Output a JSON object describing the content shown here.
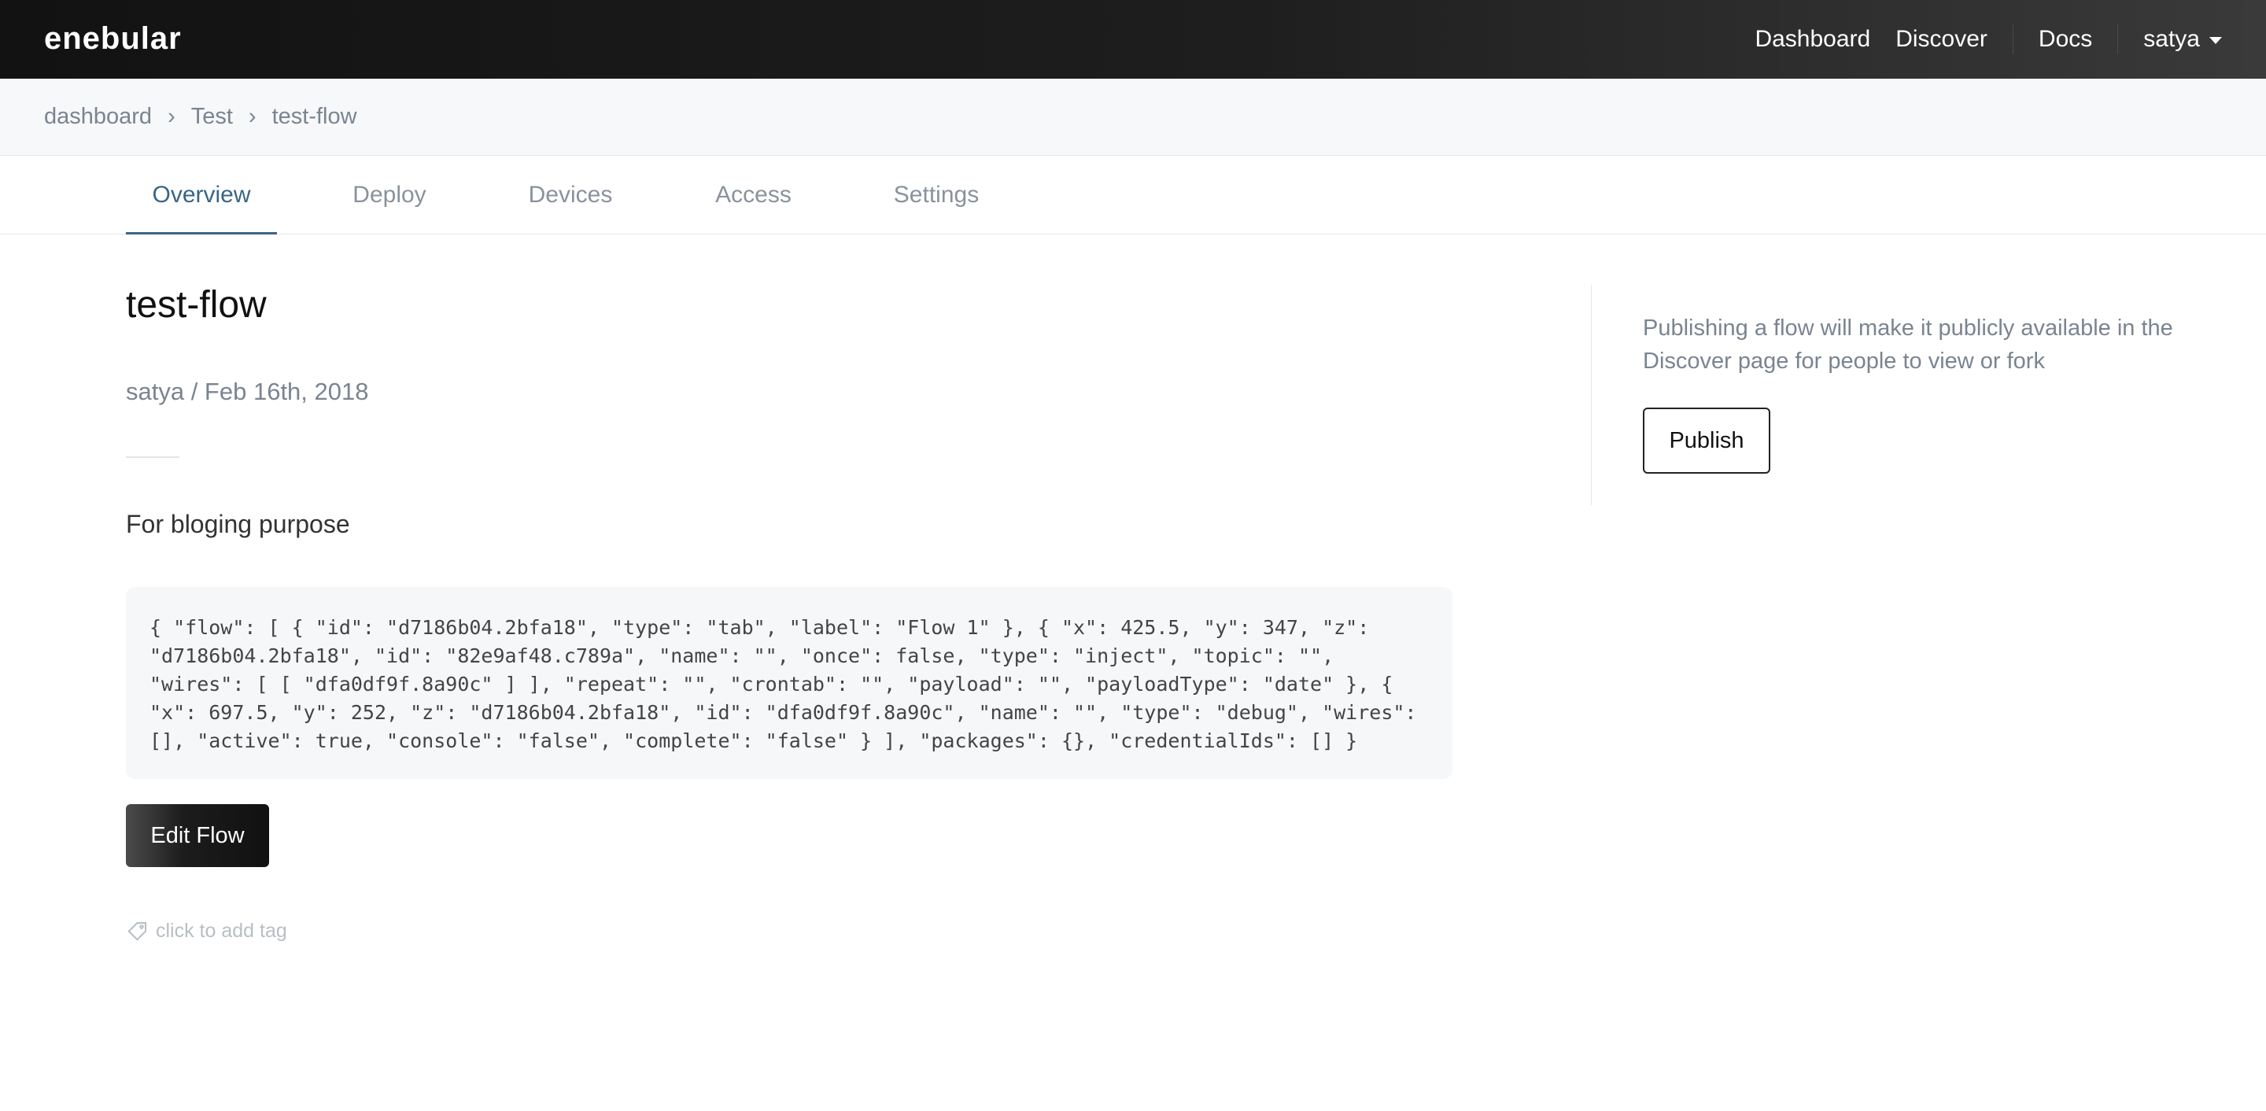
{
  "navbar": {
    "brand": "enebular",
    "links": [
      "Dashboard",
      "Discover",
      "Docs"
    ],
    "user": "satya"
  },
  "breadcrumb": [
    "dashboard",
    "Test",
    "test-flow"
  ],
  "breadcrumb_separator": "›",
  "tabs": [
    "Overview",
    "Deploy",
    "Devices",
    "Access",
    "Settings"
  ],
  "active_tab": "Overview",
  "flow": {
    "title": "test-flow",
    "meta": "satya / Feb 16th, 2018",
    "description": "For bloging purpose",
    "json": "{ \"flow\": [ { \"id\": \"d7186b04.2bfa18\", \"type\": \"tab\", \"label\": \"Flow 1\" }, { \"x\": 425.5, \"y\": 347, \"z\": \"d7186b04.2bfa18\", \"id\": \"82e9af48.c789a\", \"name\": \"\", \"once\": false, \"type\": \"inject\", \"topic\": \"\", \"wires\": [ [ \"dfa0df9f.8a90c\" ] ], \"repeat\": \"\", \"crontab\": \"\", \"payload\": \"\", \"payloadType\": \"date\" }, { \"x\": 697.5, \"y\": 252, \"z\": \"d7186b04.2bfa18\", \"id\": \"dfa0df9f.8a90c\", \"name\": \"\", \"type\": \"debug\", \"wires\": [], \"active\": true, \"console\": \"false\", \"complete\": \"false\" } ], \"packages\": {}, \"credentialIds\": [] }",
    "edit_button": "Edit Flow",
    "tag_placeholder": "click to add tag"
  },
  "publish": {
    "text": "Publishing a flow will make it publicly available in the Discover page for people to view or fork",
    "button": "Publish"
  },
  "icons": {
    "tag": "tag-icon",
    "user_menu": "chevron-down-icon"
  },
  "colors": {
    "accent": "#3a6585",
    "navbar": "#1a1a1a"
  }
}
